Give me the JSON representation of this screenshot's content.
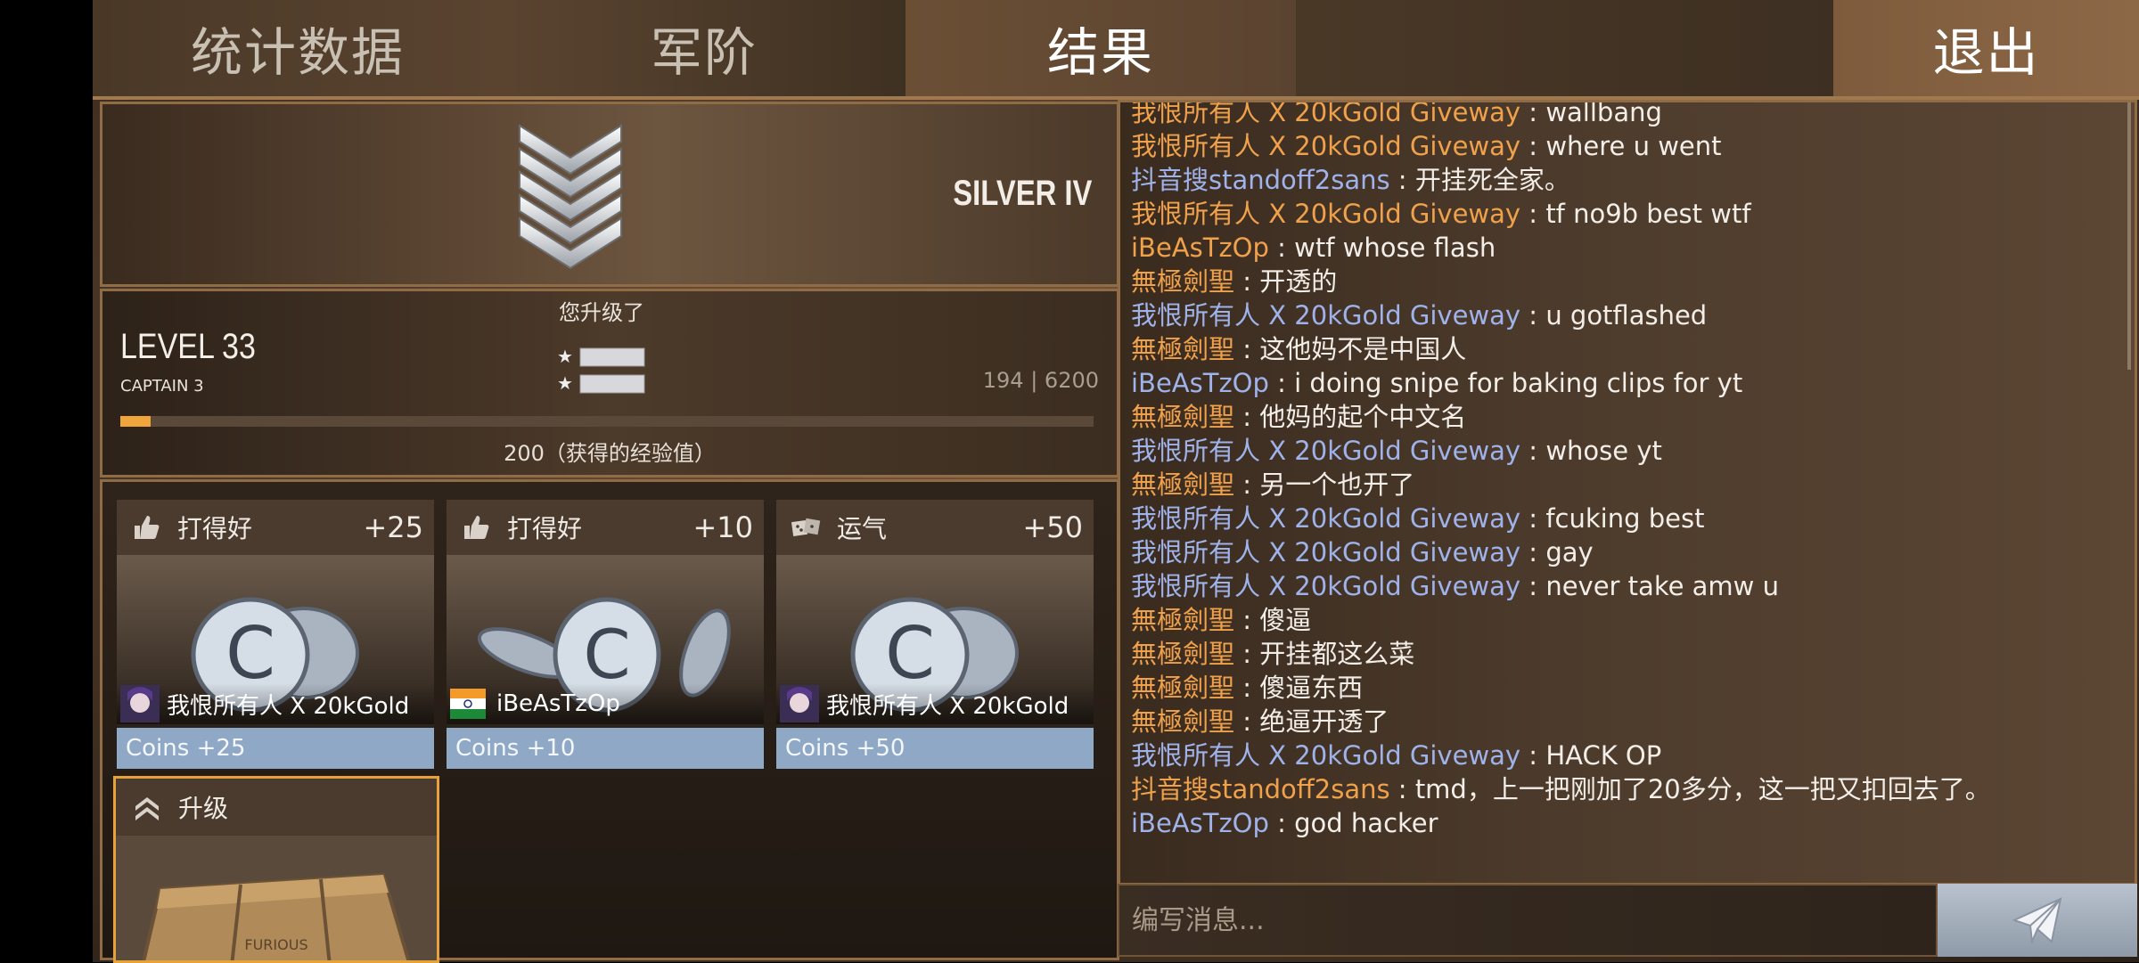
{
  "tabs": {
    "stats": "统计数据",
    "rank": "军阶",
    "result": "结果",
    "exit": "退出"
  },
  "rank": {
    "name": "SILVER IV"
  },
  "level": {
    "levelup_label": "您升级了",
    "level_text": "LEVEL 33",
    "title": "CAPTAIN 3",
    "xp_current": "194",
    "xp_separator": "|",
    "xp_total": "6200",
    "progress_fraction": 0.031,
    "gained_text": "200（获得的经验值）"
  },
  "cards": [
    {
      "title": "打得好",
      "points": "+25",
      "icon": "thumbs-up-icon",
      "player": "我恨所有人 X 20kGold",
      "flag": "anime-avatar",
      "coins": "Coins +25"
    },
    {
      "title": "打得好",
      "points": "+10",
      "icon": "thumbs-up-icon",
      "player": "iBeAsTzOp",
      "flag": "india-flag",
      "coins": "Coins +10"
    },
    {
      "title": "运气",
      "points": "+50",
      "icon": "dice-icon",
      "player": "我恨所有人 X 20kGold",
      "flag": "anime-avatar",
      "coins": "Coins +50"
    }
  ],
  "upgrade_card": {
    "title": "升级",
    "icon": "double-chevron-up-icon",
    "case_label": "FURIOUS"
  },
  "chat": {
    "separator": " : ",
    "messages": [
      {
        "name": "我恨所有人 X 20kGold Giveway",
        "color": "orange",
        "text": "wallbang"
      },
      {
        "name": "我恨所有人 X 20kGold Giveway",
        "color": "orange",
        "text": "where u went"
      },
      {
        "name": "抖音搜standoff2sans",
        "color": "blue",
        "text": "开挂死全家。"
      },
      {
        "name": "我恨所有人 X 20kGold Giveway",
        "color": "orange",
        "text": "tf no9b best wtf"
      },
      {
        "name": "iBeAsTzOp",
        "color": "orange",
        "text": "wtf whose flash"
      },
      {
        "name": "無極劍聖",
        "color": "orange",
        "text": "开透的"
      },
      {
        "name": "我恨所有人 X 20kGold Giveway",
        "color": "blue",
        "text": "u gotflashed"
      },
      {
        "name": "無極劍聖",
        "color": "orange",
        "text": "这他妈不是中国人"
      },
      {
        "name": "iBeAsTzOp",
        "color": "blue",
        "text": "i doing snipe for baking clips for yt"
      },
      {
        "name": "無極劍聖",
        "color": "orange",
        "text": "他妈的起个中文名"
      },
      {
        "name": "我恨所有人 X 20kGold Giveway",
        "color": "blue",
        "text": "whose yt"
      },
      {
        "name": "無極劍聖",
        "color": "orange",
        "text": "另一个也开了"
      },
      {
        "name": "我恨所有人 X 20kGold Giveway",
        "color": "blue",
        "text": "fcuking best"
      },
      {
        "name": "我恨所有人 X 20kGold Giveway",
        "color": "blue",
        "text": "gay"
      },
      {
        "name": "我恨所有人 X 20kGold Giveway",
        "color": "blue",
        "text": "never take amw u"
      },
      {
        "name": "無極劍聖",
        "color": "orange",
        "text": "傻逼"
      },
      {
        "name": "無極劍聖",
        "color": "orange",
        "text": "开挂都这么菜"
      },
      {
        "name": "無極劍聖",
        "color": "orange",
        "text": "傻逼东西"
      },
      {
        "name": "無極劍聖",
        "color": "orange",
        "text": "绝逼开透了"
      },
      {
        "name": "我恨所有人 X 20kGold Giveway",
        "color": "blue",
        "text": "HACK OP"
      },
      {
        "name": "抖音搜standoff2sans",
        "color": "orange",
        "text": "tmd，上一把刚加了20多分，这一把又扣回去了。"
      },
      {
        "name": "iBeAsTzOp",
        "color": "blue",
        "text": "god hacker"
      }
    ],
    "input_placeholder": "编写消息..."
  },
  "colors": {
    "name_orange": "#f0a14b",
    "name_blue": "#9fb3ea",
    "progress": "#f0a53a",
    "upgrade_border": "#e8a23a",
    "coins_bar": "#8fa8c6"
  }
}
